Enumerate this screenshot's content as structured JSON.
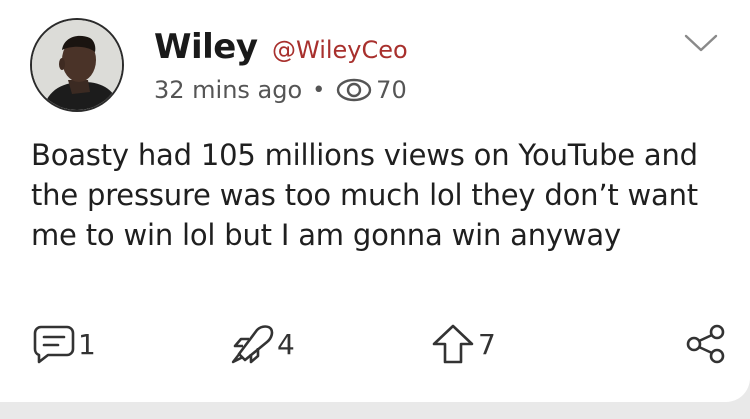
{
  "post": {
    "author_name": "Wiley",
    "author_handle": "@WileyCeo",
    "time_ago": "32 mins ago",
    "separator": "•",
    "view_count": "70",
    "text": "Boasty had 105 millions views on YouTube and the pressure was too much lol they don’t want me to win lol but I am gonna win anyway"
  },
  "actions": {
    "comments_count": "1",
    "reactions_count": "4",
    "shares_count": "7"
  },
  "icons": {
    "more": "chevron-down-icon",
    "views": "eye-icon",
    "comments": "comment-icon",
    "reactions": "rocket-icon",
    "shares": "repost-arrow-icon",
    "share": "share-icon"
  },
  "colors": {
    "handle": "#a8302d",
    "text": "#1f1f1f",
    "muted": "#555555",
    "background": "#ffffff"
  }
}
